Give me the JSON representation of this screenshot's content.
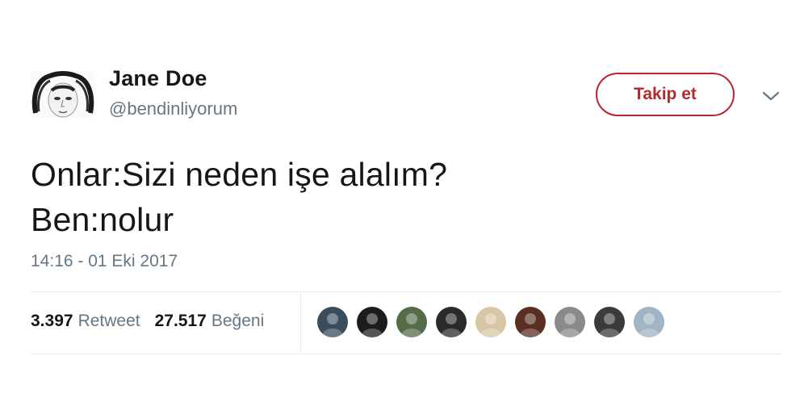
{
  "tweet": {
    "author": {
      "display_name": "Jane Doe",
      "handle": "@bendinliyorum",
      "avatar_icon": "avatar-sketch"
    },
    "follow_button": {
      "label": "Takip et",
      "color": "#b3292e"
    },
    "menu_icon": "chevron-down-icon",
    "text": "Onlar:Sizi neden işe alalım?\nBen:nolur",
    "timestamp": "14:16 - 01 Eki 2017",
    "stats": {
      "retweets": {
        "count": "3.397",
        "label": "Retweet"
      },
      "likes": {
        "count": "27.517",
        "label": "Beğeni"
      }
    },
    "liker_avatars": [
      {
        "name": "liker-1",
        "color": "#3a4d5c"
      },
      {
        "name": "liker-2",
        "color": "#1c1c1c"
      },
      {
        "name": "liker-3",
        "color": "#556b4a"
      },
      {
        "name": "liker-4",
        "color": "#2a2a2a"
      },
      {
        "name": "liker-5",
        "color": "#d9c6a5"
      },
      {
        "name": "liker-6",
        "color": "#5a2e22"
      },
      {
        "name": "liker-7",
        "color": "#8a8a8a"
      },
      {
        "name": "liker-8",
        "color": "#3b3b3b"
      },
      {
        "name": "liker-9",
        "color": "#9fb4c4"
      }
    ]
  }
}
